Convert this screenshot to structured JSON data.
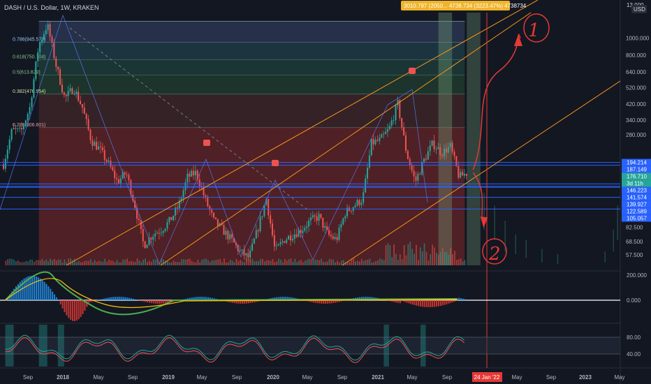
{
  "header": {
    "symbol_line": "DASH / U.S. Dollar, 1W, KRAKEN",
    "info_box": "3010.797 (2050... 4738.734 (3223.47%) 4738734",
    "currency_badge": "USD",
    "top_price": "13 000"
  },
  "fib_levels": [
    {
      "label": "0.786(945.577)",
      "price": 945.577,
      "band_color": "#2a3550"
    },
    {
      "label": "0.618(750.704)",
      "price": 750.704,
      "band_color": "#1f3a45"
    },
    {
      "label": "0.5(613.829)",
      "price": 613.829,
      "band_color": "#1d3b37"
    },
    {
      "label": "0.382(476.954)",
      "price": 476.954,
      "band_color": "#1e3a2e"
    },
    {
      "label": "0.236(306.601)",
      "price": 306.601,
      "band_color": "#3b2428"
    }
  ],
  "price_axis": {
    "ticks": [
      "13 000",
      "1000.000",
      "800.000",
      "640.000",
      "520.000",
      "420.000",
      "340.000",
      "280.000",
      "82.500",
      "68.500",
      "57.500"
    ],
    "tick_values": [
      1300,
      1000,
      800,
      640,
      520,
      420,
      340,
      280,
      82.5,
      68.5,
      57.5
    ],
    "badges": [
      {
        "text": "194.214",
        "value": 194.214,
        "color": "#2962ff"
      },
      {
        "text": "187.149",
        "value": 187.149,
        "color": "#2962ff"
      },
      {
        "text": "176.710",
        "value": 176.71,
        "color": "#26a69a"
      },
      {
        "text": "3d 11h",
        "value": 171,
        "color": "#26a69a"
      },
      {
        "text": "146.223",
        "value": 146.223,
        "color": "#2962ff"
      },
      {
        "text": "141.574",
        "value": 141.574,
        "color": "#2962ff"
      },
      {
        "text": "139.927",
        "value": 139.927,
        "color": "#2962ff"
      },
      {
        "text": "122.589",
        "value": 122.589,
        "color": "#2962ff"
      },
      {
        "text": "105.057",
        "value": 105.057,
        "color": "#2962ff"
      }
    ]
  },
  "macd_axis": {
    "ticks": [
      "200.000",
      "0.000"
    ],
    "tick_values": [
      200,
      0
    ]
  },
  "rsi_axis": {
    "ticks": [
      "80.00",
      "40.00"
    ],
    "tick_values": [
      80,
      40
    ]
  },
  "time_axis": {
    "labels": [
      "Sep",
      "2018",
      "May",
      "Sep",
      "2019",
      "May",
      "Sep",
      "2020",
      "May",
      "Sep",
      "2021",
      "May",
      "Sep",
      "May",
      "Sep",
      "2023",
      "May"
    ],
    "highlight_label": "24 Jan '22"
  },
  "annotations": {
    "wave_1": "1",
    "wave_2": "2"
  },
  "colors": {
    "background": "#131722",
    "up": "#26a69a",
    "down": "#ef5350",
    "channel": "#f7931a",
    "hline": "#2962ff",
    "info_box": "#f0b429",
    "red_zone": "#5b2226",
    "annotation": "#e53935"
  },
  "chart_data": {
    "type": "line",
    "title": "DASH / U.S. Dollar, 1W, KRAKEN",
    "ylabel": "USD",
    "scale": "log",
    "x_range": [
      "2017-08",
      "2023-06"
    ],
    "ylim": [
      50,
      1400
    ],
    "series": [
      {
        "name": "DASH/USD",
        "x": [
          "2017-08",
          "2017-09",
          "2017-10",
          "2017-11",
          "2017-12",
          "2018-01",
          "2018-02",
          "2018-03",
          "2018-04",
          "2018-05",
          "2018-06",
          "2018-07",
          "2018-08",
          "2018-09",
          "2018-10",
          "2018-11",
          "2018-12",
          "2019-01",
          "2019-02",
          "2019-03",
          "2019-04",
          "2019-05",
          "2019-06",
          "2019-07",
          "2019-08",
          "2019-09",
          "2019-10",
          "2019-11",
          "2019-12",
          "2020-01",
          "2020-02",
          "2020-03",
          "2020-04",
          "2020-05",
          "2020-06",
          "2020-07",
          "2020-08",
          "2020-09",
          "2020-10",
          "2020-11",
          "2020-12",
          "2021-01",
          "2021-02",
          "2021-03",
          "2021-04",
          "2021-05",
          "2021-06",
          "2021-07",
          "2021-08",
          "2021-09",
          "2021-10",
          "2021-11",
          "2021-12",
          "2022-01"
        ],
        "values": [
          190,
          300,
          290,
          400,
          900,
          1200,
          700,
          450,
          520,
          400,
          260,
          230,
          190,
          150,
          170,
          110,
          65,
          75,
          80,
          90,
          110,
          160,
          170,
          120,
          90,
          80,
          70,
          60,
          55,
          80,
          120,
          60,
          70,
          75,
          80,
          90,
          95,
          75,
          70,
          100,
          110,
          120,
          250,
          260,
          300,
          420,
          220,
          150,
          200,
          250,
          220,
          240,
          160,
          170
        ]
      }
    ],
    "fib_retracement": [
      {
        "level": 0.786,
        "price": 945.577
      },
      {
        "level": 0.618,
        "price": 750.704
      },
      {
        "level": 0.5,
        "price": 613.829
      },
      {
        "level": 0.382,
        "price": 476.954
      },
      {
        "level": 0.236,
        "price": 306.601
      }
    ],
    "horizontal_levels": [
      194.214,
      187.149,
      146.223,
      141.574,
      139.927,
      122.589,
      105.057
    ],
    "last_price": 176.71,
    "projection": [
      {
        "x": "2022-01",
        "value": 176.71
      },
      {
        "x": "2022-03",
        "value": 420
      },
      {
        "x": "2022-05",
        "value": 1050
      },
      {
        "x": "2022-06",
        "value": 1150
      }
    ],
    "projection_down": [
      {
        "x": "2022-01",
        "value": 176.71
      },
      {
        "x": "2022-03",
        "value": 110
      },
      {
        "x": "2022-05",
        "value": 72
      }
    ]
  }
}
